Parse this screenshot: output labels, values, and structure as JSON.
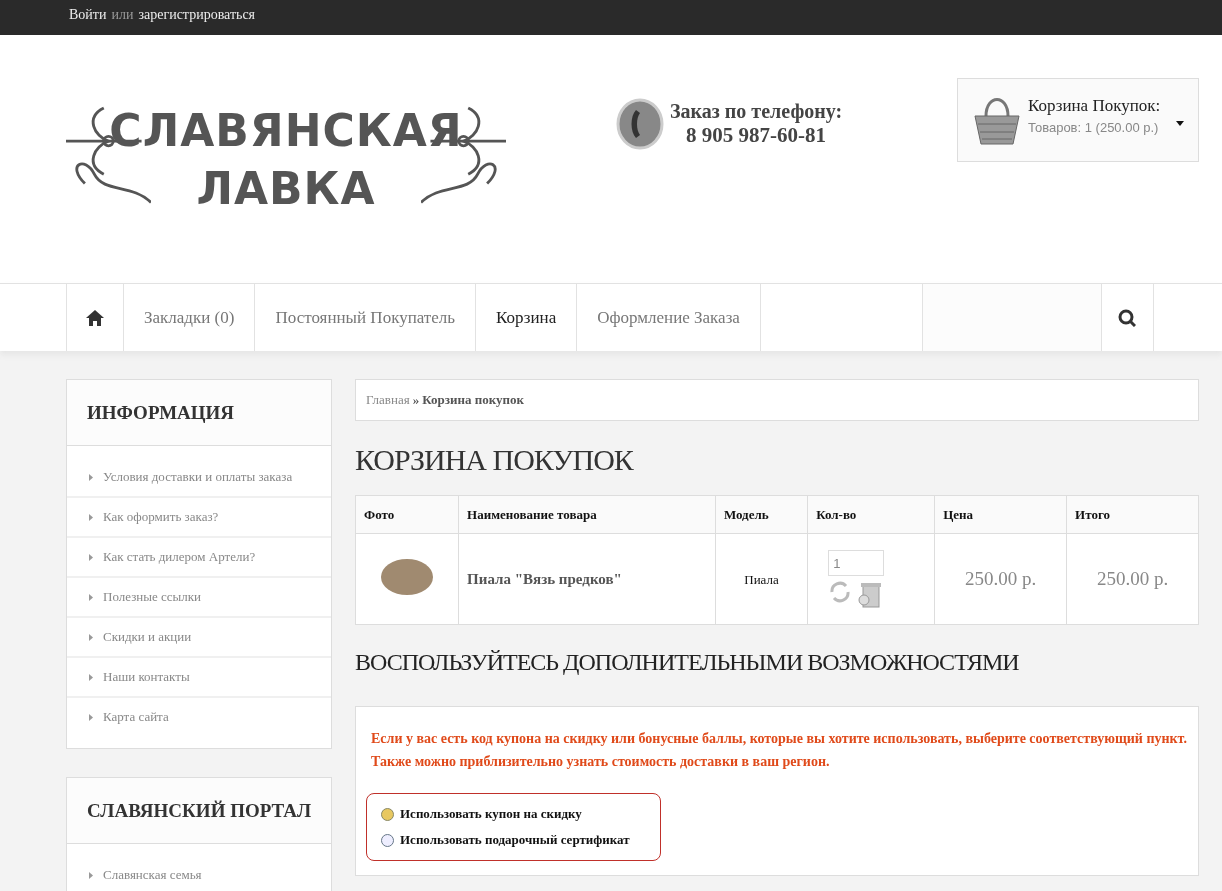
{
  "top_bar": {
    "login": "Войти",
    "or": "или",
    "register": "зарегистрироваться"
  },
  "logo": {
    "line_1": "СЛАВЯНСКАЯ",
    "line_2": "ЛАВКА"
  },
  "phone": {
    "label": "Заказ по телефону:",
    "number": "8 905 987-60-81"
  },
  "cart_widget": {
    "title": "Корзина Покупок:",
    "summary": "Товаров: 1 (250.00 р.)"
  },
  "nav": {
    "items": [
      {
        "label": "Закладки (0)",
        "selected": false
      },
      {
        "label": "Постоянный Покупатель",
        "selected": false
      },
      {
        "label": "Корзина",
        "selected": true
      },
      {
        "label": "Оформление Заказа",
        "selected": false
      }
    ]
  },
  "sidebar": [
    {
      "title": "ИНФОРМАЦИЯ",
      "items": [
        "Условия доставки и оплаты заказа",
        "Как оформить заказ?",
        "Как стать дилером Артели?",
        "Полезные ссылки",
        "Скидки и акции",
        "Наши контакты",
        "Карта сайта"
      ]
    },
    {
      "title": "СЛАВЯНСКИЙ ПОРТАЛ",
      "items": [
        "Славянская семья"
      ]
    }
  ],
  "breadcrumb": {
    "home": "Главная",
    "separator": "»",
    "current": "Корзина покупок"
  },
  "page_title": "КОРЗИНА ПОКУПОК",
  "table": {
    "columns": [
      "Фото",
      "Наименование товара",
      "Модель",
      "Кол-во",
      "Цена",
      "Итого"
    ],
    "rows": [
      {
        "name": "Пиала \"Вязь предков\"",
        "model": "Пиала",
        "quantity": "1",
        "price": "250.00 р.",
        "total": "250.00 р."
      }
    ]
  },
  "extras": {
    "title": "ВОСПОЛЬЗУЙТЕСЬ ДОПОЛНИТЕЛЬНЫМИ ВОЗМОЖНОСТЯМИ",
    "notice": "Если у вас есть код купона на скидку или бонусные баллы, которые вы хотите использовать, выберите соответствующий пункт. Также можно приблизительно узнать стоимость доставки в ваш регион.",
    "options": [
      {
        "label": "Использовать купон на скидку",
        "selected": true
      },
      {
        "label": "Использовать подарочный сертификат",
        "selected": false
      }
    ]
  }
}
